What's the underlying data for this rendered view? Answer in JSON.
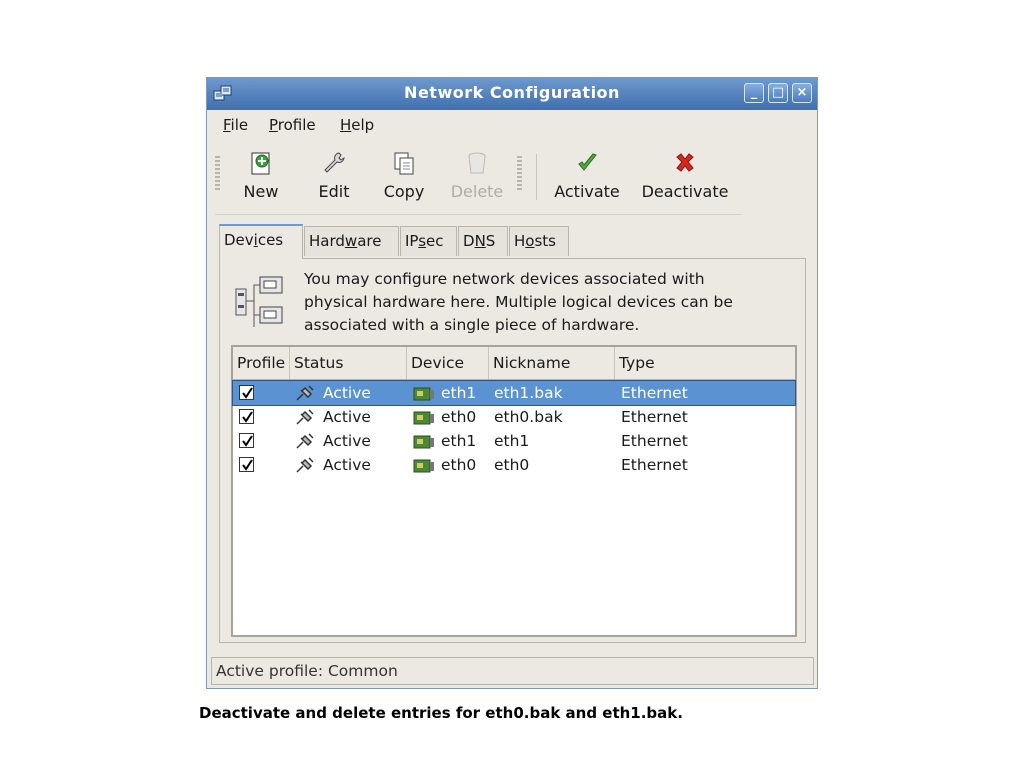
{
  "window": {
    "title": "Network Configuration",
    "buttons": {
      "minimize": "_",
      "maximize": "□",
      "close": "×"
    }
  },
  "menu": [
    {
      "key": "F",
      "rest": "ile"
    },
    {
      "key": "P",
      "rest": "rofile"
    },
    {
      "key": "H",
      "rest": "elp"
    }
  ],
  "toolbar": {
    "new_label": "New",
    "edit_label": "Edit",
    "copy_label": "Copy",
    "delete_label": "Delete",
    "activate_label": "Activate",
    "deactivate_label": "Deactivate"
  },
  "tabs": [
    {
      "pre": "Dev",
      "key": "i",
      "post": "ces",
      "active": true
    },
    {
      "pre": "Hard",
      "key": "w",
      "post": "are",
      "active": false
    },
    {
      "pre": "IP",
      "key": "s",
      "post": "ec",
      "active": false
    },
    {
      "pre": "D",
      "key": "N",
      "post": "S",
      "active": false
    },
    {
      "pre": "H",
      "key": "o",
      "post": "sts",
      "active": false
    }
  ],
  "devices_panel": {
    "info_lines": [
      "You may configure network devices associated with",
      "physical hardware here.  Multiple logical devices can be",
      "associated with a single piece of hardware."
    ],
    "columns": [
      "Profile",
      "Status",
      "Device",
      "Nickname",
      "Type"
    ],
    "rows": [
      {
        "profile": true,
        "status": "Active",
        "device": "eth1",
        "nickname": "eth1.bak",
        "type": "Ethernet",
        "selected": true
      },
      {
        "profile": true,
        "status": "Active",
        "device": "eth0",
        "nickname": "eth0.bak",
        "type": "Ethernet",
        "selected": false
      },
      {
        "profile": true,
        "status": "Active",
        "device": "eth1",
        "nickname": "eth1",
        "type": "Ethernet",
        "selected": false
      },
      {
        "profile": true,
        "status": "Active",
        "device": "eth0",
        "nickname": "eth0",
        "type": "Ethernet",
        "selected": false
      }
    ]
  },
  "statusbar": {
    "text": "Active profile: Common"
  },
  "caption": "Deactivate and delete entries for eth0.bak and eth1.bak.",
  "colors": {
    "titlebar": "#3f6fae",
    "selection": "#5b93d2",
    "window_bg": "#ece9e3"
  }
}
